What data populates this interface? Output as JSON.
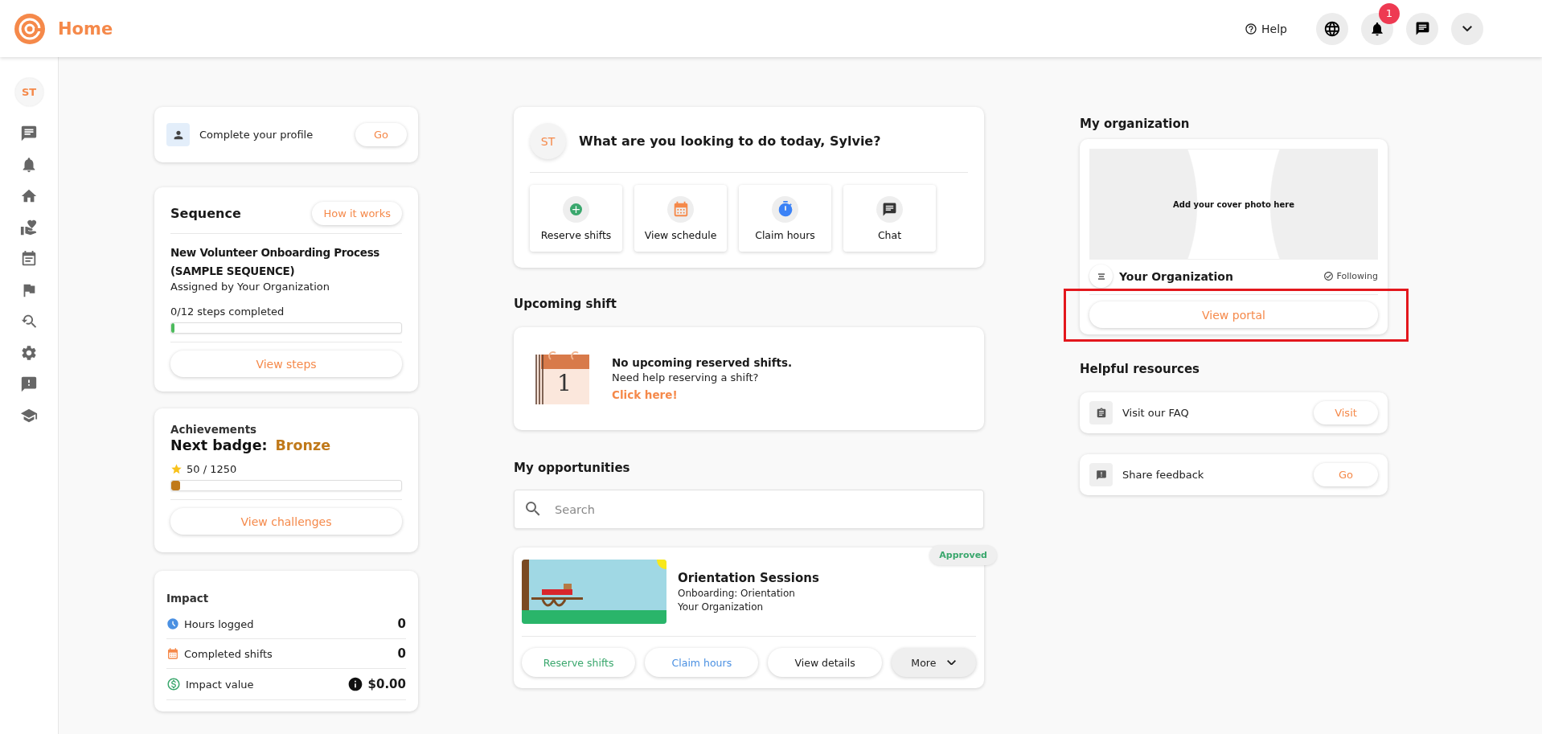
{
  "header": {
    "title": "Home",
    "help": "Help",
    "notification_count": "1"
  },
  "sidebar": {
    "avatar": "ST"
  },
  "profile_card": {
    "label": "Complete your profile",
    "button": "Go"
  },
  "sequence": {
    "title": "Sequence",
    "how_button": "How it works",
    "name": "New Volunteer Onboarding Process (SAMPLE SEQUENCE)",
    "assigned": "Assigned by Your Organization",
    "progress_text": "0/12 steps completed",
    "level": 0,
    "button": "View steps"
  },
  "achievements": {
    "title": "Achievements",
    "next_label": "Next badge:",
    "badge": "Bronze",
    "points": "50 / 1250",
    "level": 0.04,
    "button": "View challenges"
  },
  "impact": {
    "title": "Impact",
    "rows": [
      {
        "kind": "hours",
        "label": "Hours logged",
        "value": "0"
      },
      {
        "kind": "shifts",
        "label": "Completed shifts",
        "value": "0"
      },
      {
        "kind": "value",
        "label": "Impact value",
        "value": "$0.00"
      }
    ]
  },
  "welcome": {
    "avatar": "ST",
    "question": "What are you looking to do today, Sylvie?",
    "actions": [
      {
        "kind": "reserve",
        "label": "Reserve shifts"
      },
      {
        "kind": "schedule",
        "label": "View schedule"
      },
      {
        "kind": "claim",
        "label": "Claim hours"
      },
      {
        "kind": "chat",
        "label": "Chat"
      }
    ]
  },
  "upcoming": {
    "heading": "Upcoming shift",
    "calendar_day": "1",
    "title": "No upcoming reserved shifts.",
    "text": "Need help reserving a shift?",
    "link": "Click here!"
  },
  "opportunities": {
    "heading": "My opportunities",
    "search_placeholder": "Search",
    "items": [
      {
        "kind": "picture",
        "title": "Orientation Sessions",
        "category": "Onboarding: Orientation",
        "organization": "Your Organization",
        "status": "Approved",
        "buttons": [
          {
            "kind": "reserve",
            "label": "Reserve shifts"
          },
          {
            "kind": "claim",
            "label": "Claim hours"
          },
          {
            "kind": "details",
            "label": "View details"
          },
          {
            "kind": "more",
            "label": "More"
          }
        ]
      }
    ]
  },
  "organization": {
    "heading": "My organization",
    "cover_text": "Add your cover photo here",
    "name": "Your Organization",
    "following": "Following",
    "button": "View portal",
    "highlighted": true
  },
  "resources": {
    "heading": "Helpful resources",
    "items": [
      {
        "kind": "faq",
        "label": "Visit our FAQ",
        "button": "Visit"
      },
      {
        "kind": "feedback",
        "label": "Share feedback",
        "button": "Go"
      }
    ]
  }
}
